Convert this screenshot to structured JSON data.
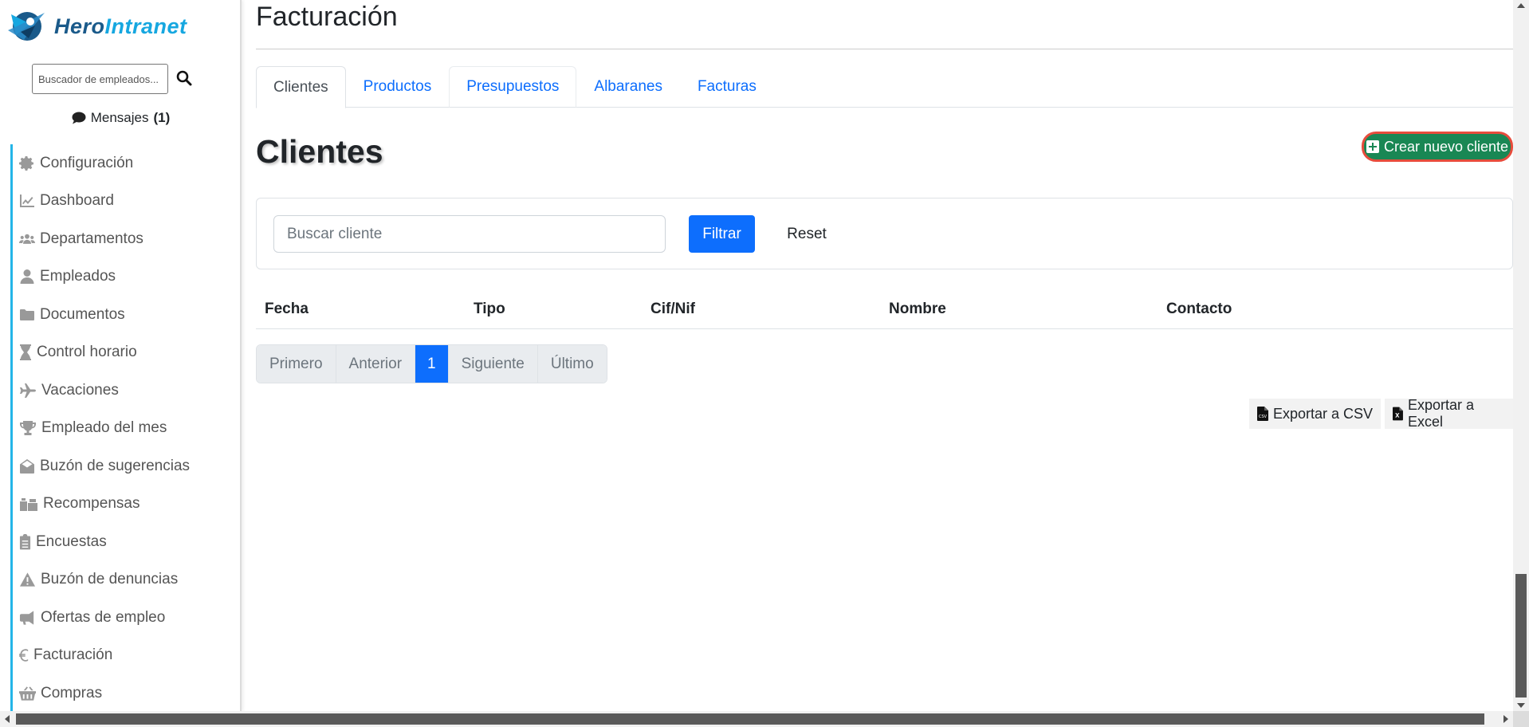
{
  "brand": {
    "part1": "Hero",
    "part2": "Intranet"
  },
  "sidebar": {
    "search_placeholder": "Buscador de empleados...",
    "messages_label": "Mensajes",
    "messages_count": "(1)",
    "items": [
      {
        "label": "Configuración",
        "icon": "gear-icon"
      },
      {
        "label": "Dashboard",
        "icon": "chart-line-icon"
      },
      {
        "label": "Departamentos",
        "icon": "users-icon"
      },
      {
        "label": "Empleados",
        "icon": "user-icon"
      },
      {
        "label": "Documentos",
        "icon": "folder-icon"
      },
      {
        "label": "Control horario",
        "icon": "hourglass-icon"
      },
      {
        "label": "Vacaciones",
        "icon": "plane-icon"
      },
      {
        "label": "Empleado del mes",
        "icon": "trophy-icon"
      },
      {
        "label": "Buzón de sugerencias",
        "icon": "envelope-open-icon"
      },
      {
        "label": "Recompensas",
        "icon": "gifts-icon"
      },
      {
        "label": "Encuestas",
        "icon": "clipboard-list-icon"
      },
      {
        "label": "Buzón de denuncias",
        "icon": "warning-icon"
      },
      {
        "label": "Ofertas de empleo",
        "icon": "bullhorn-icon"
      },
      {
        "label": "Facturación",
        "icon": "euro-icon"
      },
      {
        "label": "Compras",
        "icon": "basket-icon"
      }
    ]
  },
  "main": {
    "page_title": "Facturación",
    "tabs": [
      {
        "label": "Clientes"
      },
      {
        "label": "Productos"
      },
      {
        "label": "Presupuestos"
      },
      {
        "label": "Albaranes"
      },
      {
        "label": "Facturas"
      }
    ],
    "section_title": "Clientes",
    "create_button": "Crear nuevo cliente",
    "filter": {
      "search_placeholder": "Buscar cliente",
      "filter_button": "Filtrar",
      "reset_button": "Reset"
    },
    "table_headers": [
      "Fecha",
      "Tipo",
      "Cif/Nif",
      "Nombre",
      "Contacto"
    ],
    "pagination": {
      "first": "Primero",
      "prev": "Anterior",
      "current": "1",
      "next": "Siguiente",
      "last": "Último"
    },
    "export_csv": "Exportar a CSV",
    "export_excel": "Exportar a Excel"
  },
  "colors": {
    "accent": "#0d6efd",
    "success": "#198754",
    "highlight_ring": "#e74c3c",
    "sidebar_rule": "#24b5e8"
  }
}
